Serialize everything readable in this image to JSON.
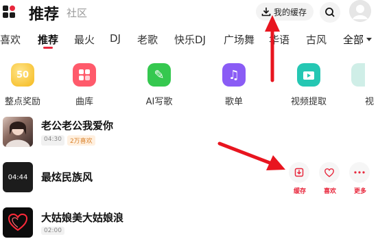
{
  "header": {
    "title": "推荐",
    "subtitle": "社区",
    "cache_label": "我的缓存"
  },
  "tabs": [
    "喜欢",
    "推荐",
    "最火",
    "DJ",
    "老歌",
    "快乐DJ",
    "广场舞",
    "华语",
    "古风"
  ],
  "tab_all": "全部",
  "shortcuts": [
    {
      "label": "整点奖励",
      "icon": "coin-icon",
      "icon_text": "50"
    },
    {
      "label": "曲库",
      "icon": "library-icon"
    },
    {
      "label": "AI写歌",
      "icon": "ai-write-icon"
    },
    {
      "label": "歌单",
      "icon": "playlist-icon"
    },
    {
      "label": "视频提取",
      "icon": "video-extract-icon"
    },
    {
      "label": "视",
      "icon": "more-shortcut-icon"
    }
  ],
  "songs": [
    {
      "title": "老公老公我爱你",
      "duration": "04:30",
      "badge": "2万喜欢"
    },
    {
      "title": "最炫民族风",
      "duration": "04:44",
      "cover_text": "04:44"
    },
    {
      "title": "大姑娘美大姑娘浪",
      "duration": "02:00"
    }
  ],
  "actions": {
    "cache": "缓存",
    "like": "喜欢",
    "more": "更多"
  },
  "colors": {
    "accent": "#e8273c",
    "arrow": "#e8151f"
  }
}
